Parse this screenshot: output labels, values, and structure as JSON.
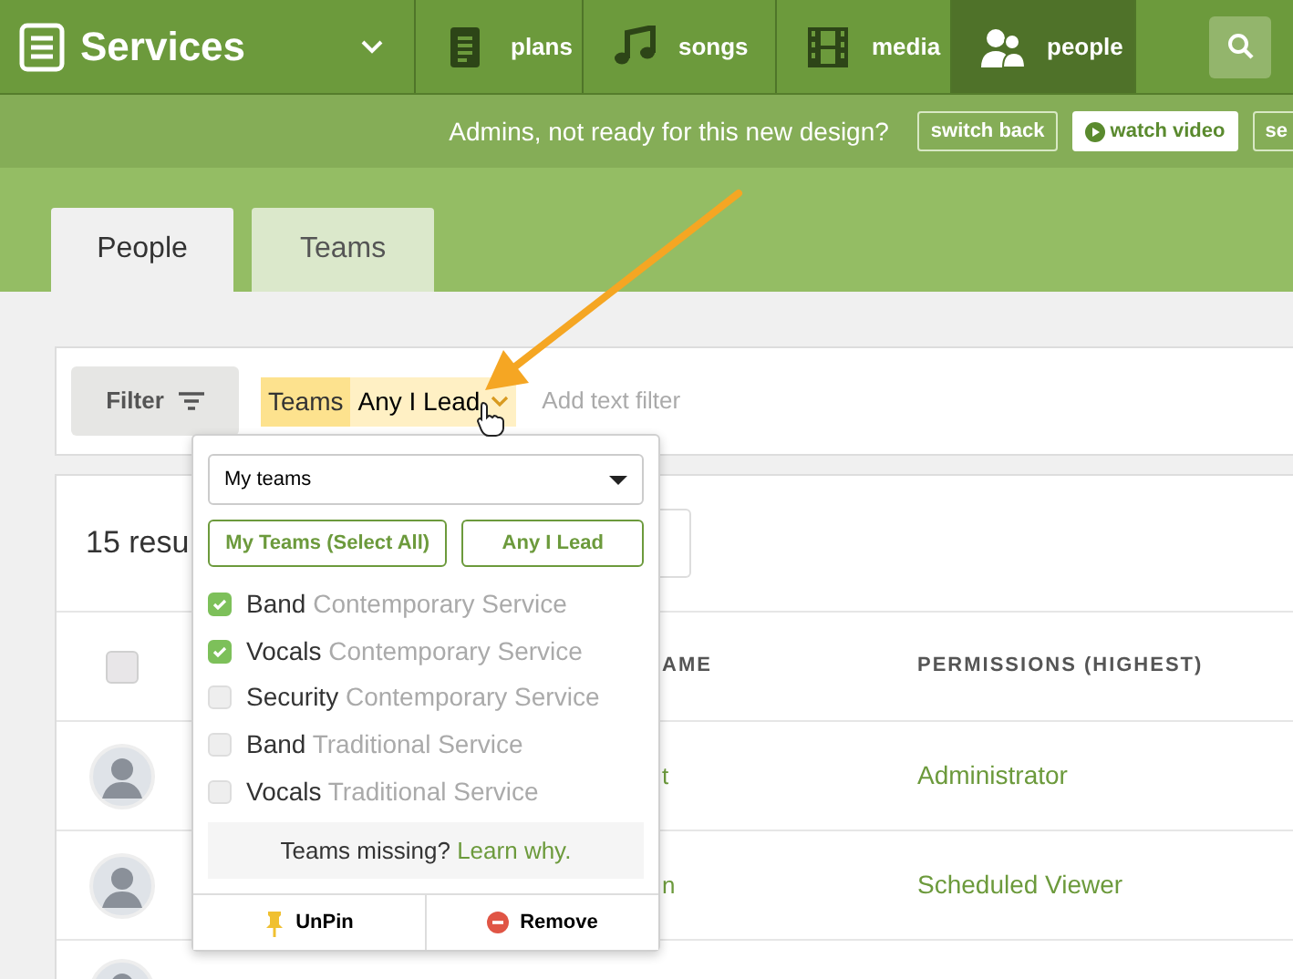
{
  "nav": {
    "brand": "Services",
    "items": [
      {
        "label": "plans",
        "selected": false
      },
      {
        "label": "songs",
        "selected": false
      },
      {
        "label": "media",
        "selected": false
      },
      {
        "label": "people",
        "selected": true
      }
    ]
  },
  "banner": {
    "text": "Admins, not ready for this new design?",
    "buttons": [
      {
        "label": "switch back",
        "kind": "outline"
      },
      {
        "label": "watch video",
        "kind": "solid"
      },
      {
        "label": "se",
        "kind": "outline"
      }
    ]
  },
  "tabs": [
    {
      "label": "People",
      "selected": true
    },
    {
      "label": "Teams",
      "selected": false
    }
  ],
  "filter": {
    "button": "Filter",
    "chip": {
      "name": "Teams",
      "value": "Any I Lead"
    },
    "placeholder": "Add text filter"
  },
  "results": {
    "count": "15 resu",
    "select_all_checked": false,
    "columns": [
      "AME",
      "PERMISSIONS (HIGHEST)"
    ],
    "rows": [
      {
        "name": "t",
        "permission": "Administrator"
      },
      {
        "name": "n",
        "permission": "Scheduled Viewer"
      }
    ]
  },
  "dropdown": {
    "select": "My teams",
    "buttons": [
      "My Teams (Select All)",
      "Any I Lead"
    ],
    "teams": [
      {
        "name": "Band",
        "service": "Contemporary Service",
        "checked": true
      },
      {
        "name": "Vocals",
        "service": "Contemporary Service",
        "checked": true
      },
      {
        "name": "Security",
        "service": "Contemporary Service",
        "checked": false
      },
      {
        "name": "Band",
        "service": "Traditional Service",
        "checked": false
      },
      {
        "name": "Vocals",
        "service": "Traditional Service",
        "checked": false
      }
    ],
    "missing": {
      "text": "Teams missing?",
      "link": "Learn why."
    },
    "footer": [
      {
        "label": "UnPin",
        "kind": "pin"
      },
      {
        "label": "Remove",
        "kind": "remove"
      }
    ]
  }
}
